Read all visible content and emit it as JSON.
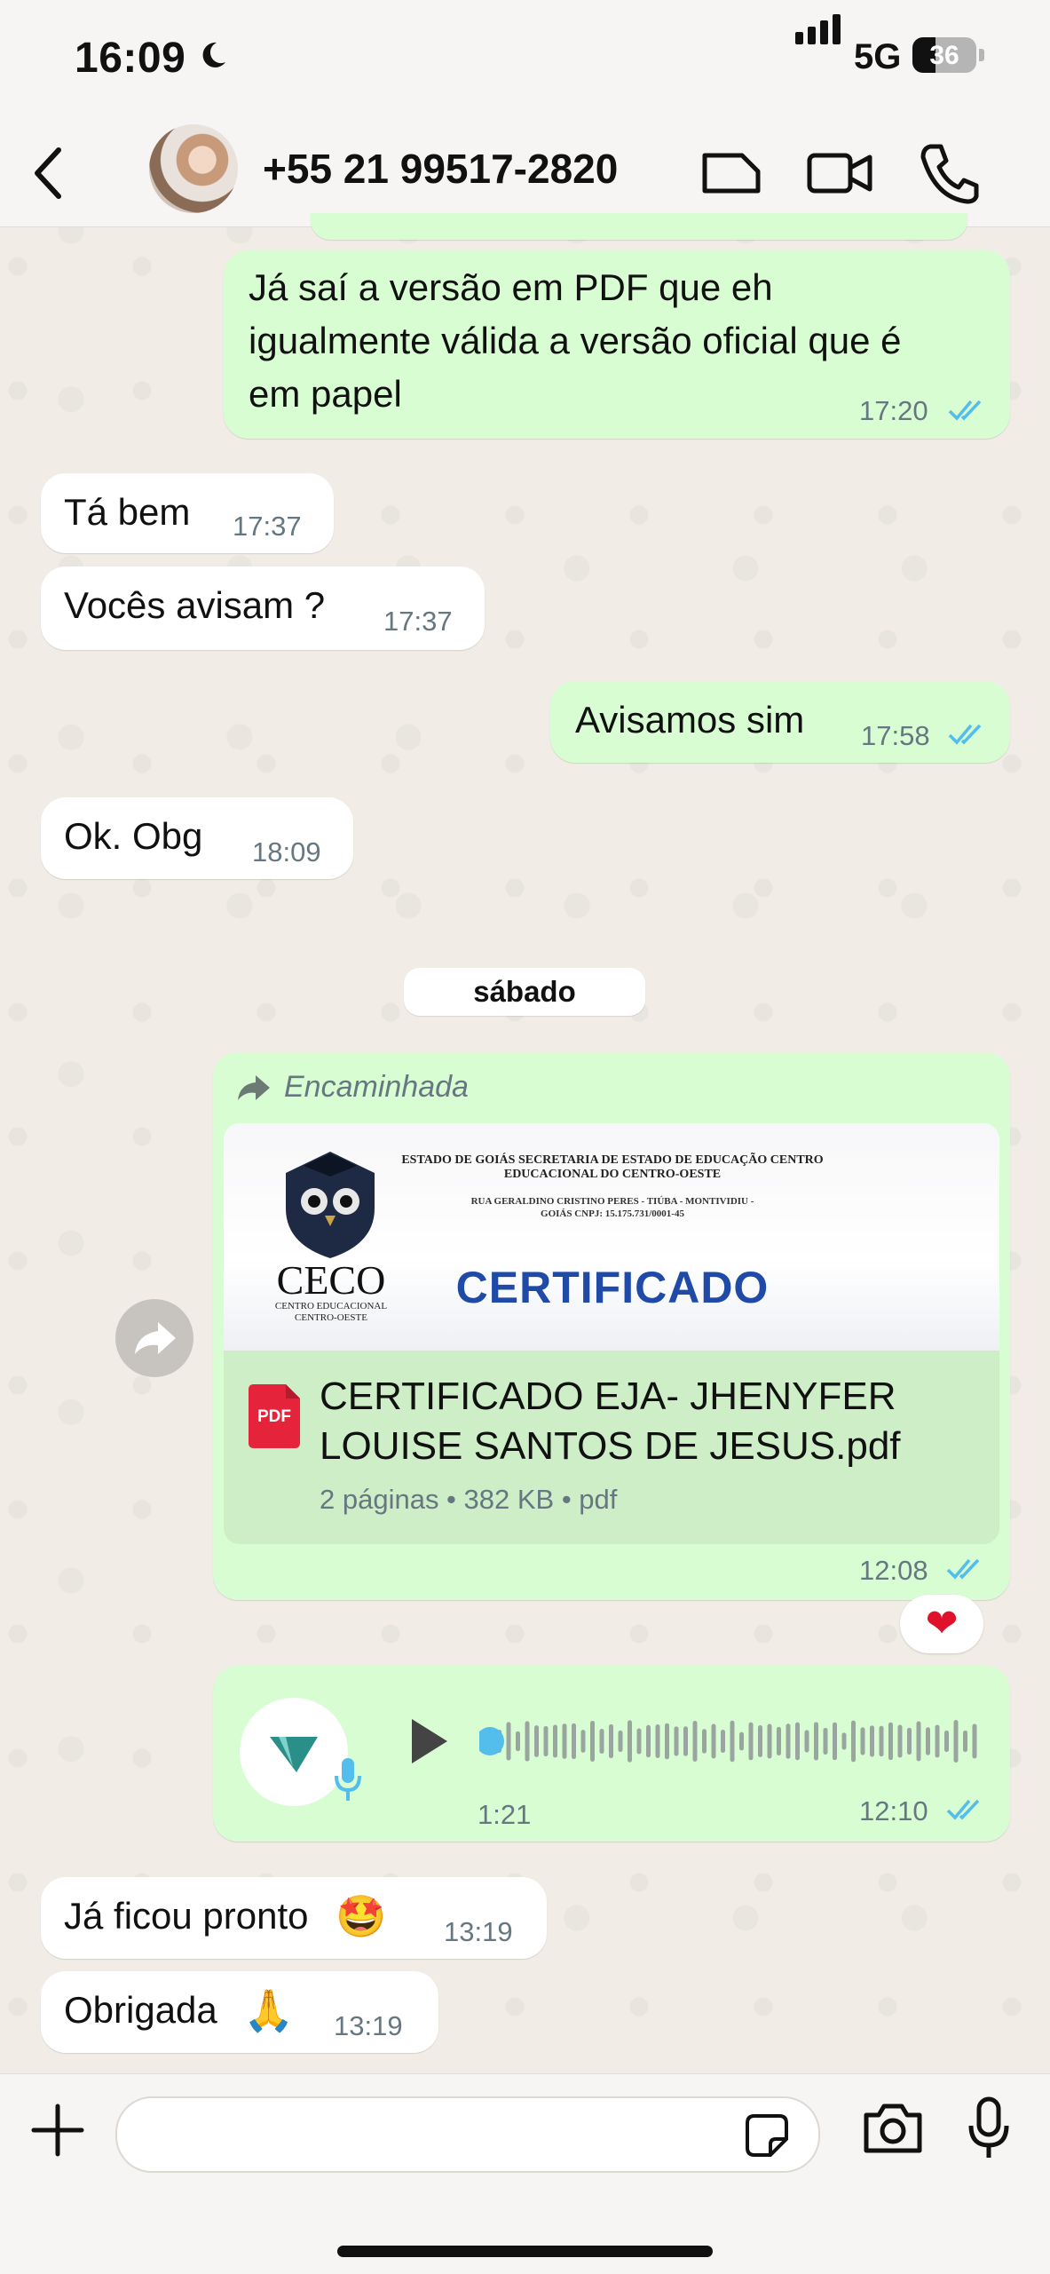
{
  "status_bar": {
    "time": "16:09",
    "network": "5G",
    "battery": "36"
  },
  "header": {
    "contact": "+55 21 99517-2820"
  },
  "messages": [
    {
      "dir": "out",
      "text_lines": [
        "Já saí a versão em PDF que eh",
        "igualmente válida a versão oficial que é",
        "em papel"
      ],
      "time": "17:20"
    },
    {
      "dir": "in",
      "text": "Tá bem",
      "time": "17:37"
    },
    {
      "dir": "in",
      "text": "Vocês avisam ?",
      "time": "17:37"
    },
    {
      "dir": "out",
      "text": "Avisamos sim",
      "time": "17:58"
    },
    {
      "dir": "in",
      "text": "Ok. Obg",
      "time": "18:09"
    }
  ],
  "date_separator": "sábado",
  "document_message": {
    "forwarded_label": "Encaminhada",
    "preview": {
      "header_line1": "ESTADO DE GOIÁS SECRETARIA DE ESTADO DE EDUCAÇÃO CENTRO",
      "header_line2": "EDUCACIONAL DO CENTRO-OESTE",
      "address_line1": "RUA GERALDINO CRISTINO PERES - TIÚBA - MONTIVIDIU -",
      "address_line2": "GOIÁS CNPJ: 15.175.731/0001-45",
      "logo_text": "CECO",
      "logo_sub1": "CENTRO EDUCACIONAL",
      "logo_sub2": "CENTRO-OESTE",
      "title": "CERTIFICADO"
    },
    "file_icon_label": "PDF",
    "file_name_line1": "CERTIFICADO EJA- JHENYFER",
    "file_name_line2": "LOUISE SANTOS DE JESUS.pdf",
    "file_meta": "2 páginas • 382 KB • pdf",
    "time": "12:08",
    "reaction": "❤"
  },
  "voice_message": {
    "duration": "1:21",
    "time": "12:10",
    "progress": 0.0
  },
  "later_messages": [
    {
      "dir": "in",
      "text": "Já ficou pronto",
      "emoji": "🤩",
      "time": "13:19"
    },
    {
      "dir": "in",
      "text": "Obrigada",
      "emoji": "🙏",
      "time": "13:19"
    }
  ],
  "colors": {
    "outgoing_bubble": "#d9fdd3",
    "incoming_bubble": "#ffffff",
    "read_ticks": "#53bdeb",
    "pdf_red": "#e5243b",
    "certificado_blue": "#1f4aa8"
  },
  "icons": [
    "moon-icon",
    "back-icon",
    "sticker-icon",
    "video-call-icon",
    "phone-icon",
    "forward-icon",
    "pdf-icon",
    "play-icon",
    "mic-icon",
    "plus-icon",
    "camera-icon"
  ]
}
